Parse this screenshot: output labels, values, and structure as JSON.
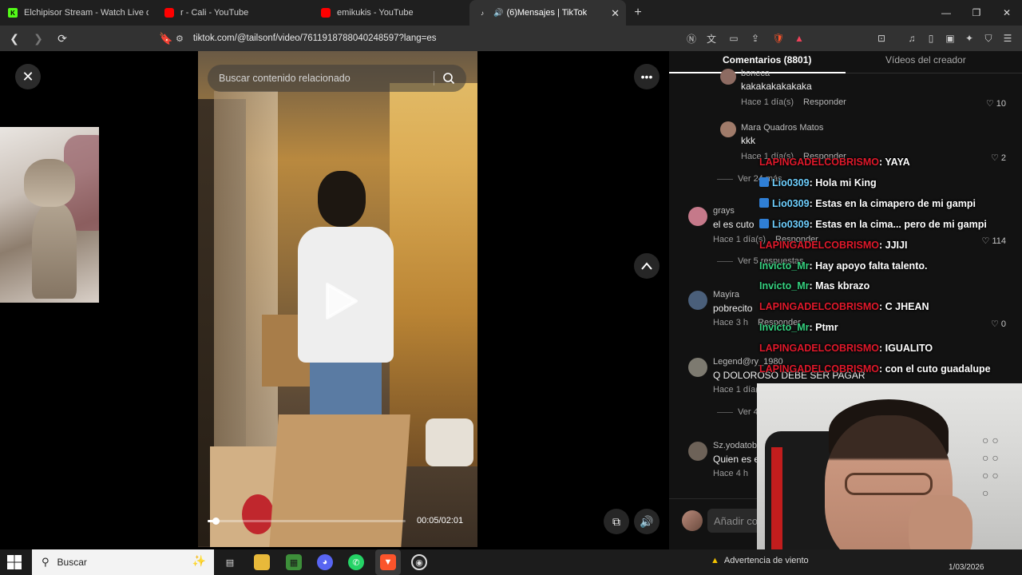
{
  "browser": {
    "tabs": [
      {
        "label": "Elchipisor Stream - Watch Live on",
        "favicon_color": "#53fc18",
        "favicon_letter": "K"
      },
      {
        "label": "r - Cali - YouTube",
        "favicon_color": "#ff0000",
        "favicon_letter": ""
      },
      {
        "label": "emikukis - YouTube",
        "favicon_color": "#ff0000",
        "favicon_letter": ""
      },
      {
        "label": "(6)Mensajes | TikTok",
        "favicon_color": "#ffffff",
        "favicon_letter": "♪",
        "active": true
      }
    ],
    "url": "tiktok.com/@tailsonf/video/7611918788040248597?lang=es"
  },
  "video": {
    "search_placeholder": "Buscar contenido relacionado",
    "timecode": "00:05/02:01",
    "progress_fraction": 0.041
  },
  "comments_panel": {
    "tab_comments": "Comentarios (8801)",
    "tab_creator": "Vídeos del creador",
    "reply_label": "Responder",
    "add_comment_placeholder": "Añadir co",
    "items": [
      {
        "user": "boneca",
        "text": "kakakakakakaka",
        "time": "Hace 1 día(s)",
        "likes": "10"
      },
      {
        "user": "Mara Quadros Matos",
        "text": "kkk",
        "time": "Hace 1 día(s)",
        "likes": "2",
        "replies": "Ver 24 más"
      },
      {
        "user": "grays",
        "text": "el es cuto",
        "time": "Hace 1 día(s)",
        "likes": "114",
        "replies": "Ver 5 respuestas"
      },
      {
        "user": "Mayira",
        "text": "pobrecito",
        "time": "Hace 3 h",
        "likes": "0"
      },
      {
        "user": "Legend@ry_1980",
        "text": "Q DOLOROSO DEBE SER PAGAR",
        "time": "Hace 1 día(s)",
        "replies": "Ver 4"
      },
      {
        "user": "Sz.yodatob",
        "text": "Quien es e",
        "time": "Hace 4 h"
      }
    ]
  },
  "chat": {
    "colors": {
      "red": "#e0192b",
      "blue": "#6fd0ff",
      "green": "#35d07f"
    },
    "messages": [
      {
        "user": "LAPINGADELCOBRISMO",
        "msg": ": YAYA",
        "color": "red",
        "badge": false
      },
      {
        "user": "Lio0309",
        "msg": ": Hola mi King",
        "color": "blue",
        "badge": true
      },
      {
        "user": "Lio0309",
        "msg": ": Estas en la cimapero de mi gampi",
        "color": "blue",
        "badge": true
      },
      {
        "user": "Lio0309",
        "msg": ": Estas en la cima... pero de mi gampi",
        "color": "blue",
        "badge": true
      },
      {
        "user": "LAPINGADELCOBRISMO",
        "msg": ": JJIJI",
        "color": "red",
        "badge": false
      },
      {
        "user": "Invicto_Mr",
        "msg": ": Hay apoyo falta talento.",
        "color": "green",
        "badge": false
      },
      {
        "user": "Invicto_Mr",
        "msg": ": Mas kbrazo",
        "color": "green",
        "badge": false
      },
      {
        "user": "LAPINGADELCOBRISMO",
        "msg": ": C JHEAN",
        "color": "red",
        "badge": false
      },
      {
        "user": "Invicto_Mr",
        "msg": ": Ptmr",
        "color": "green",
        "badge": false
      },
      {
        "user": "LAPINGADELCOBRISMO",
        "msg": ": IGUALITO",
        "color": "red",
        "badge": false
      },
      {
        "user": "LAPINGADELCOBRISMO",
        "msg": ": con el cuto guadalupe",
        "color": "red",
        "badge": false
      }
    ]
  },
  "taskbar": {
    "search_label": "Buscar",
    "warning": "Advertencia de viento",
    "date": "1/03/2026"
  }
}
